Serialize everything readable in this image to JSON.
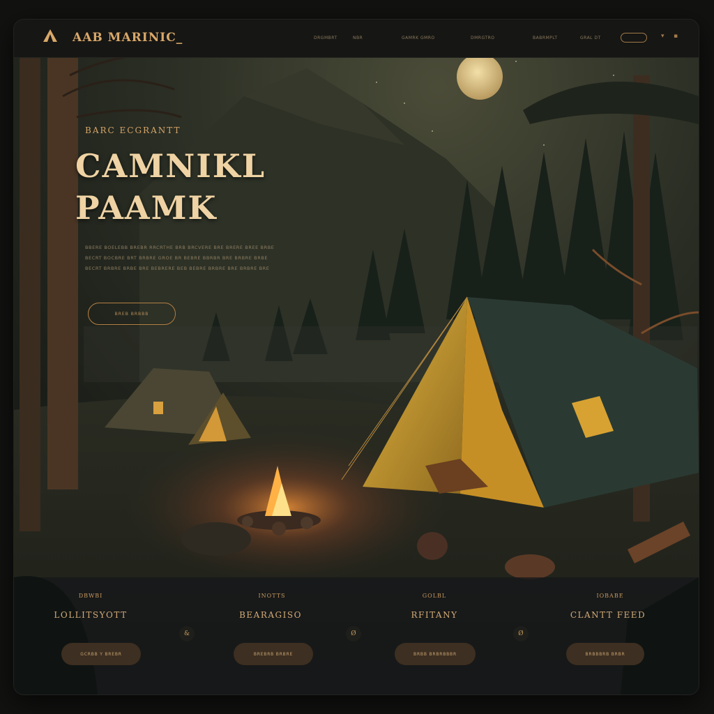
{
  "nav": {
    "brand": "AAB MARINIC_",
    "links": [
      "DRGMBRT",
      "NBR",
      "GAMRK GMRO",
      "DMRGTRO",
      "BABRMPLT",
      "GRAL DT"
    ]
  },
  "hero": {
    "eyebrow": "BARC ECGRANTT",
    "title_line1": "CAMNIKL",
    "title_line2": "PAAMK",
    "desc_lines": [
      "BBERE BOELEBB BREBR RRCRTHE BRB BRCVERE BRE BRERE BREE BRBE",
      "BECRT BOCBRE BRT BRBRE GROE BR BEBRE BBRBR BRE BRBRE BRBE",
      "BECRT BRBRE BRBE BRE BEBRERE BEB BEBRE BRBRE BRE BRBRE BRE"
    ],
    "cta_label": "BREB BRBBB"
  },
  "features": [
    {
      "label": "DBWBI",
      "title": "LOLLITSYOTT",
      "button": "GCRBB Y BREBR"
    },
    {
      "label": "INOTTS",
      "title": "BEARAGISO",
      "button": "BREBRB BRBRE"
    },
    {
      "label": "GOLBL",
      "title": "RFITANY",
      "button": "BRBB BRBRBBBR"
    },
    {
      "label": "IOBABE",
      "title": "CLANTT FEED",
      "button": "BRBBBRB BRBR"
    }
  ],
  "feature_icons": [
    "&",
    "Ø",
    "Ø"
  ],
  "colors": {
    "accent": "#d9a86a",
    "background": "#1a1d18",
    "button": "#3d2f21"
  }
}
